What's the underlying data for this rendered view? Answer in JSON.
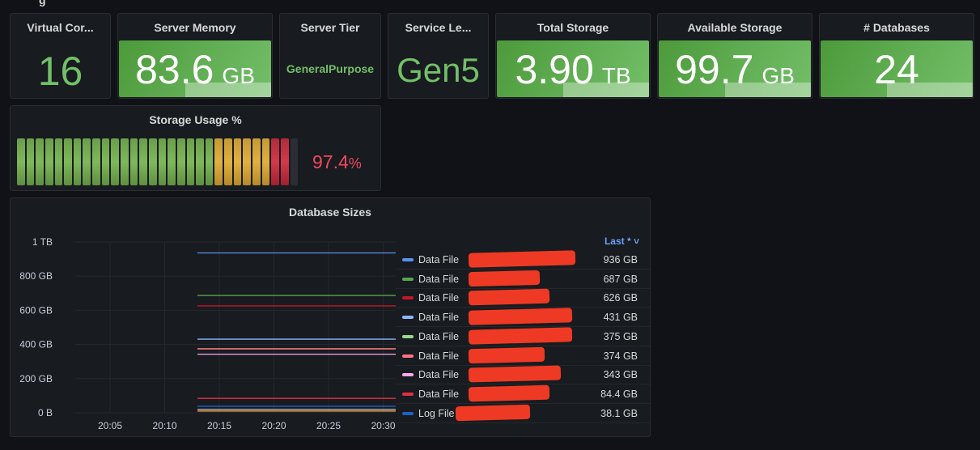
{
  "top_header_fragment": "g",
  "stats": [
    {
      "title": "Virtual Cor...",
      "value": "16",
      "unit": "",
      "style": "text"
    },
    {
      "title": "Server Memory",
      "value": "83.6",
      "unit": "GB",
      "style": "box"
    },
    {
      "title": "Server Tier",
      "value": "GeneralPurpose",
      "unit": "",
      "style": "text-small"
    },
    {
      "title": "Service Le...",
      "value": "Gen5",
      "unit": "",
      "style": "text"
    },
    {
      "title": "Total Storage",
      "value": "3.90",
      "unit": "TB",
      "style": "box"
    },
    {
      "title": "Available Storage",
      "value": "99.7",
      "unit": "GB",
      "style": "box"
    },
    {
      "title": "# Databases",
      "value": "24",
      "unit": "",
      "style": "box"
    }
  ],
  "storage_usage": {
    "title": "Storage Usage %",
    "value": "97.4",
    "unit": "%",
    "percent": 97.4
  },
  "database_sizes": {
    "title": "Database Sizes",
    "legend_header": "Last * ˅",
    "rows": [
      {
        "name": "Data File",
        "value": "936 GB",
        "color": "#5794f2"
      },
      {
        "name": "Data File",
        "value": "687 GB",
        "color": "#56a64b"
      },
      {
        "name": "Data File",
        "value": "626 GB",
        "color": "#c4162a"
      },
      {
        "name": "Data File",
        "value": "431 GB",
        "color": "#8ab8ff"
      },
      {
        "name": "Data File",
        "value": "375 GB",
        "color": "#96d98d"
      },
      {
        "name": "Data File",
        "value": "374 GB",
        "color": "#ff7383"
      },
      {
        "name": "Data File",
        "value": "343 GB",
        "color": "#ffa6ec"
      },
      {
        "name": "Data File",
        "value": "84.4 GB",
        "color": "#e02f44"
      },
      {
        "name": "Log File",
        "value": "38.1 GB",
        "color": "#1f60c4"
      }
    ]
  },
  "chart_data": {
    "type": "line",
    "title": "Database Sizes",
    "y_ticks": [
      "1 TB",
      "800 GB",
      "600 GB",
      "400 GB",
      "200 GB",
      "0 B"
    ],
    "x_ticks": [
      "20:05",
      "20:10",
      "20:15",
      "20:20",
      "20:25",
      "20:30"
    ],
    "y_unit": "GB",
    "ylim": [
      0,
      1000
    ],
    "series_start": "20:13",
    "series": [
      {
        "name": "Data File",
        "last": 936,
        "color": "#5794f2"
      },
      {
        "name": "Data File",
        "last": 687,
        "color": "#56a64b"
      },
      {
        "name": "Data File",
        "last": 626,
        "color": "#c4162a"
      },
      {
        "name": "Data File",
        "last": 431,
        "color": "#8ab8ff"
      },
      {
        "name": "Data File",
        "last": 375,
        "color": "#96d98d"
      },
      {
        "name": "Data File",
        "last": 374,
        "color": "#ff7383"
      },
      {
        "name": "Data File",
        "last": 343,
        "color": "#ffa6ec"
      },
      {
        "name": "Data File",
        "last": 84.4,
        "color": "#e02f44"
      },
      {
        "name": "Log File",
        "last": 38.1,
        "color": "#1f60c4"
      },
      {
        "name": "",
        "last": 20,
        "color": "#c0c0c0"
      },
      {
        "name": "",
        "last": 10,
        "color": "#ffb357"
      }
    ]
  }
}
